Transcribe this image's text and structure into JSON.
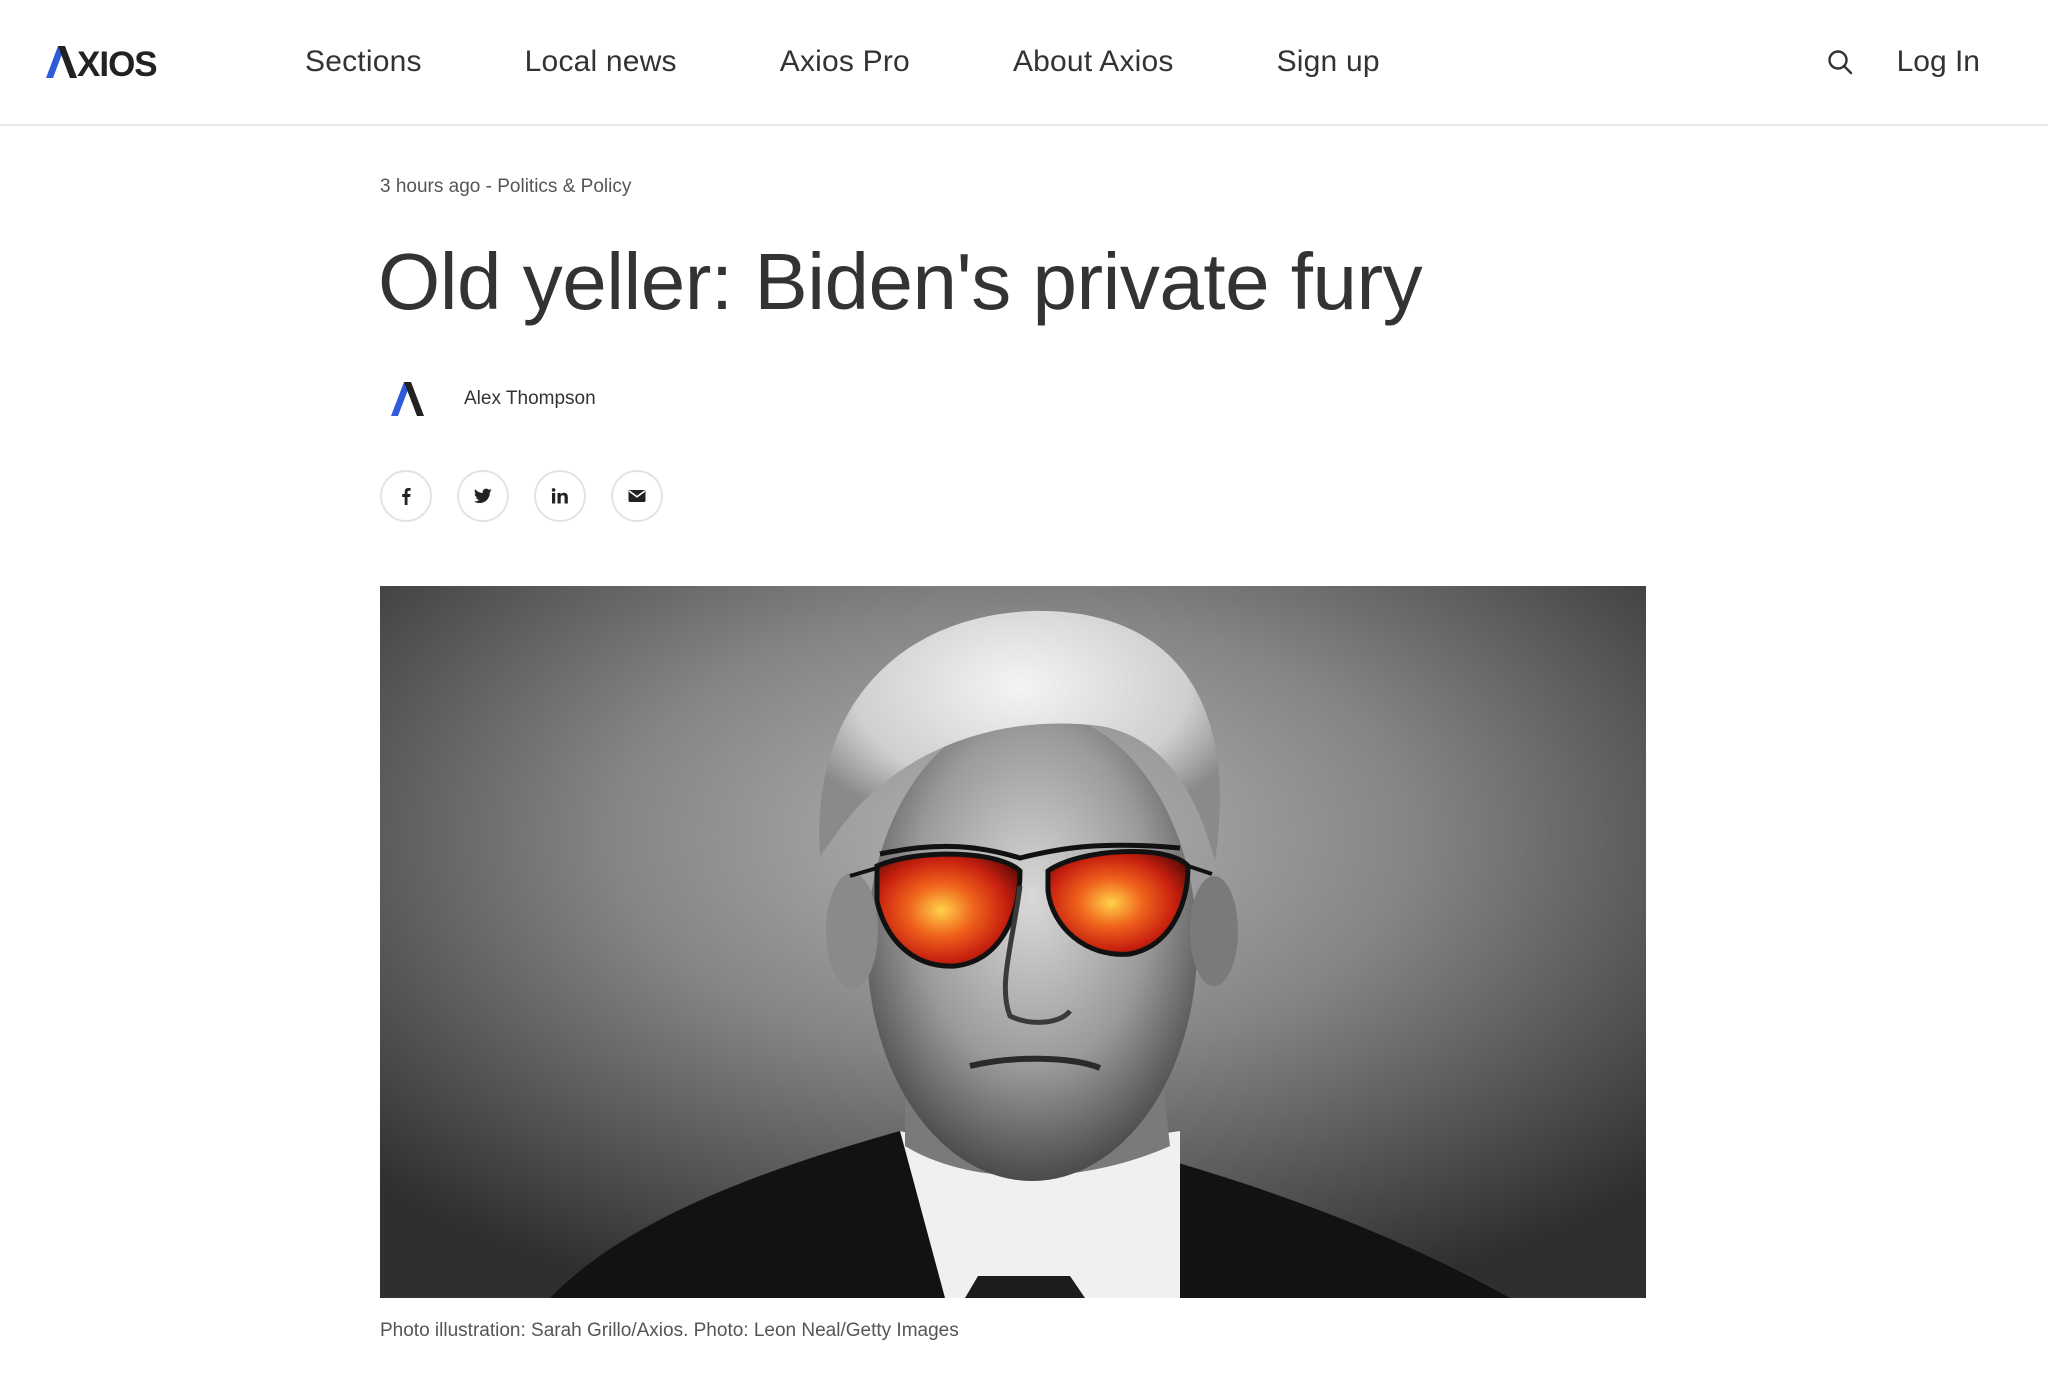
{
  "header": {
    "logo_text": "AXIOS",
    "nav": [
      "Sections",
      "Local news",
      "Axios Pro",
      "About Axios",
      "Sign up"
    ],
    "login_label": "Log In",
    "search_icon": "search-icon"
  },
  "article": {
    "timestamp": "3 hours ago",
    "separator": " - ",
    "category": "Politics & Policy",
    "headline": "Old yeller: Biden's private fury",
    "author": "Alex Thompson",
    "share_icons": [
      "facebook-icon",
      "twitter-icon",
      "linkedin-icon",
      "email-icon"
    ],
    "caption": "Photo illustration: Sarah Grillo/Axios. Photo: Leon Neal/Getty Images"
  },
  "colors": {
    "text": "#333333",
    "logo_blue": "#2e5bd8",
    "muted": "#555555",
    "lens_fire": "#e8401a"
  }
}
